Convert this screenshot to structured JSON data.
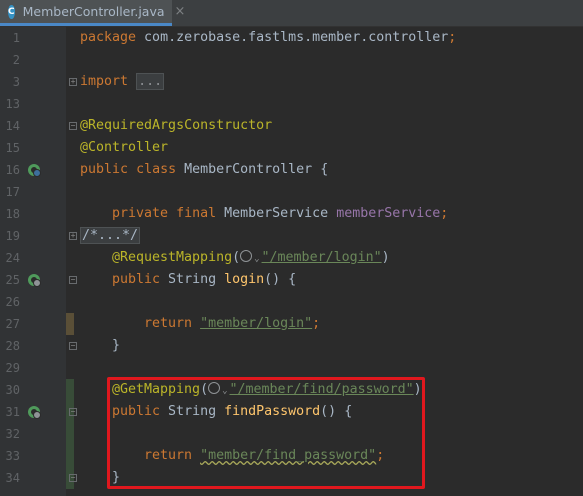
{
  "tab": {
    "icon_letter": "C",
    "file_name": "MemberController.java",
    "close_glyph": "×"
  },
  "colors": {
    "background": "#2b2b2b",
    "keyword": "#cc7832",
    "annotation": "#bbb529",
    "string": "#6a8759",
    "field": "#9876aa",
    "method": "#ffc66d",
    "highlight_border": "#e0181e"
  },
  "lines": {
    "l1": {
      "num": "1",
      "t1": "package",
      "t2": " com.zerobase.fastlms.member.controller",
      "t3": ";"
    },
    "l2": {
      "num": "2"
    },
    "l3": {
      "num": "3",
      "t1": "import",
      "t2": " ",
      "t3": "..."
    },
    "l13": {
      "num": "13"
    },
    "l14": {
      "num": "14",
      "t1": "@RequiredArgsConstructor"
    },
    "l15": {
      "num": "15",
      "t1": "@Controller"
    },
    "l16": {
      "num": "16",
      "t1": "public",
      "t2": " ",
      "t3": "class",
      "t4": " MemberController {"
    },
    "l17": {
      "num": "17"
    },
    "l18": {
      "num": "18",
      "t1": "private",
      "t2": " ",
      "t3": "final",
      "t4": " MemberService ",
      "t5": "memberService",
      "t6": ";"
    },
    "l19": {
      "num": "19",
      "t1": "/*...*/"
    },
    "l24": {
      "num": "24",
      "t1": "@RequestMapping",
      "t2": "(",
      "t3": "\"/member/login\"",
      "t4": ")"
    },
    "l25": {
      "num": "25",
      "t1": "public",
      "t2": " String ",
      "t3": "login",
      "t4": "() {"
    },
    "l26": {
      "num": "26"
    },
    "l27": {
      "num": "27",
      "t1": "return",
      "t2": " ",
      "t3": "\"member/login\"",
      "t4": ";"
    },
    "l28": {
      "num": "28",
      "t1": "}"
    },
    "l29": {
      "num": "29"
    },
    "l30": {
      "num": "30",
      "t1": "@GetMapping",
      "t2": "(",
      "t3": "\"/member/find/password\"",
      "t4": ")"
    },
    "l31": {
      "num": "31",
      "t1": "public",
      "t2": " String ",
      "t3": "findPassword",
      "t4": "() {"
    },
    "l32": {
      "num": "32"
    },
    "l33": {
      "num": "33",
      "t1": "return",
      "t2": " ",
      "t3": "\"member/find_password\"",
      "t4": ";"
    },
    "l34": {
      "num": "34",
      "t1": "}"
    }
  }
}
